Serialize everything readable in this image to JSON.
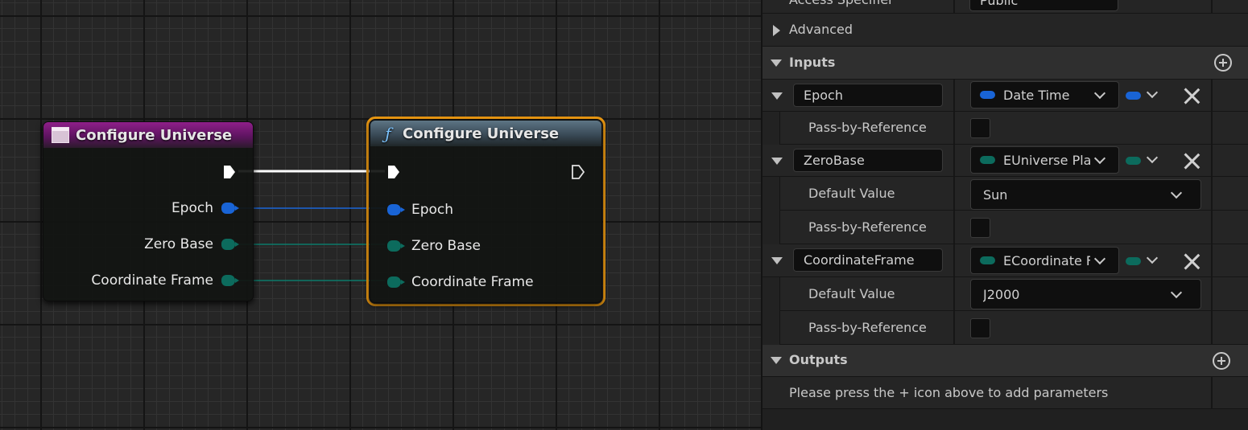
{
  "graph": {
    "entry_node": {
      "title": "Configure Universe",
      "icon": "event-node-icon",
      "outputs": [
        {
          "label": "Epoch",
          "color": "#1964d6"
        },
        {
          "label": "Zero Base",
          "color": "#0c6b5d"
        },
        {
          "label": "Coordinate Frame",
          "color": "#0c6b5d"
        }
      ]
    },
    "call_node": {
      "title": "Configure Universe",
      "icon": "function-icon",
      "inputs": [
        {
          "label": "Epoch",
          "color": "#1964d6"
        },
        {
          "label": "Zero Base",
          "color": "#0c6b5d"
        },
        {
          "label": "Coordinate Frame",
          "color": "#0c6b5d"
        }
      ],
      "selected_outline_color": "#f29d12"
    }
  },
  "details": {
    "access_specifier": {
      "label": "Access Specifier",
      "value": "Public"
    },
    "advanced": {
      "label": "Advanced"
    },
    "inputs_section": {
      "label": "Inputs"
    },
    "inputs": [
      {
        "name": "Epoch",
        "type": "Date Time",
        "type_color": "#1964d6",
        "pass_by_reference_label": "Pass-by-Reference"
      },
      {
        "name": "ZeroBase",
        "type": "EUniverse Plar",
        "type_color": "#0c6b5d",
        "default_value_label": "Default Value",
        "default_value": "Sun",
        "pass_by_reference_label": "Pass-by-Reference"
      },
      {
        "name": "CoordinateFrame",
        "type": "ECoordinate Fr",
        "type_color": "#0c6b5d",
        "default_value_label": "Default Value",
        "default_value": "J2000",
        "pass_by_reference_label": "Pass-by-Reference"
      }
    ],
    "outputs_section": {
      "label": "Outputs"
    },
    "outputs_hint": "Please press the + icon above to add parameters"
  }
}
